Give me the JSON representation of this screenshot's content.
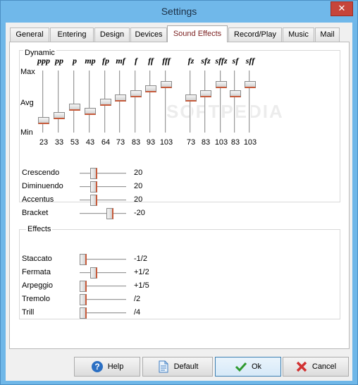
{
  "window": {
    "title": "Settings",
    "close_glyph": "✕"
  },
  "tabs": [
    {
      "label": "General"
    },
    {
      "label": "Entering"
    },
    {
      "label": "Design"
    },
    {
      "label": "Devices"
    },
    {
      "label": "Sound Effects",
      "active": true
    },
    {
      "label": "Record/Play"
    },
    {
      "label": "Music"
    },
    {
      "label": "Mail"
    }
  ],
  "dynamic": {
    "title": "Dynamic",
    "scale": {
      "max": "Max",
      "avg": "Avg",
      "min": "Min"
    },
    "range": [
      0,
      127
    ],
    "sliders": [
      {
        "marking": "ppp",
        "value": 23
      },
      {
        "marking": "pp",
        "value": 33
      },
      {
        "marking": "p",
        "value": 53
      },
      {
        "marking": "mp",
        "value": 43
      },
      {
        "marking": "fp",
        "value": 64
      },
      {
        "marking": "mf",
        "value": 73
      },
      {
        "marking": "f",
        "value": 83
      },
      {
        "marking": "ff",
        "value": 93
      },
      {
        "marking": "fff",
        "value": 103
      },
      {
        "marking": "fz",
        "value": 73
      },
      {
        "marking": "sfz",
        "value": 83
      },
      {
        "marking": "sffz",
        "value": 103
      },
      {
        "marking": "sf",
        "value": 83
      },
      {
        "marking": "sff",
        "value": 103
      }
    ],
    "horizontal": [
      {
        "label": "Crescendo",
        "value": "20",
        "level": 0.3
      },
      {
        "label": "Diminuendo",
        "value": "20",
        "level": 0.3
      },
      {
        "label": "Accentus",
        "value": "20",
        "level": 0.3
      },
      {
        "label": "Bracket",
        "value": "-20",
        "level": 0.65
      }
    ]
  },
  "effects": {
    "title": "Effects",
    "sliders": [
      {
        "label": "Staccato",
        "value": "-1/2",
        "level": 0.0
      },
      {
        "label": "Fermata",
        "value": "+1/2",
        "level": 0.22
      },
      {
        "label": "Arpeggio",
        "value": "+1/5",
        "level": 0.0
      },
      {
        "label": "Tremolo",
        "value": "/2",
        "level": 0.0
      },
      {
        "label": "Trill",
        "value": "/4",
        "level": 0.0
      }
    ]
  },
  "watermark": "SOFTPEDIA",
  "buttons": {
    "help": {
      "label": "Help",
      "icon": "help-icon"
    },
    "default": {
      "label": "Default",
      "icon": "document-icon"
    },
    "ok": {
      "label": "Ok",
      "icon": "checkmark-icon"
    },
    "cancel": {
      "label": "Cancel",
      "icon": "cancel-x-icon"
    }
  },
  "colors": {
    "titlebar": "#70b8ea",
    "close_button": "#c7453a",
    "active_tab_text": "#7a1e1e",
    "thumb_accent": "#c75a3a"
  }
}
